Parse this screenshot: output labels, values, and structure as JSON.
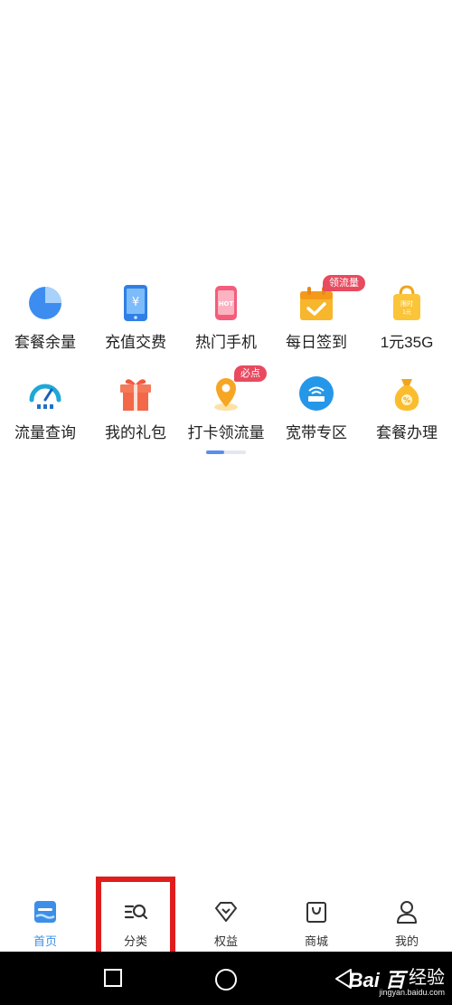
{
  "grid": {
    "row1": [
      {
        "label": "套餐余量",
        "icon": "pie-chart-icon"
      },
      {
        "label": "充值交费",
        "icon": "phone-yen-icon",
        "glyph": "¥"
      },
      {
        "label": "热门手机",
        "icon": "hot-phone-icon",
        "glyph": "HOT"
      },
      {
        "label": "每日签到",
        "icon": "calendar-check-icon",
        "badge": "领流量"
      },
      {
        "label": "1元35G",
        "icon": "shopping-bag-icon",
        "glyph1": "限时",
        "glyph2": "1元"
      }
    ],
    "row2": [
      {
        "label": "流量查询",
        "icon": "speedometer-icon"
      },
      {
        "label": "我的礼包",
        "icon": "gift-box-icon"
      },
      {
        "label": "打卡领流量",
        "icon": "location-pin-icon",
        "badge": "必点"
      },
      {
        "label": "宽带专区",
        "icon": "router-icon"
      },
      {
        "label": "套餐办理",
        "icon": "money-bag-icon",
        "glyph": "%"
      }
    ]
  },
  "pager": {
    "current": 1,
    "total": 2
  },
  "tabs": [
    {
      "label": "首页",
      "icon": "home-icon",
      "active": true
    },
    {
      "label": "分类",
      "icon": "category-search-icon"
    },
    {
      "label": "权益",
      "icon": "diamond-icon"
    },
    {
      "label": "商城",
      "icon": "shopping-bag-icon"
    },
    {
      "label": "我的",
      "icon": "user-icon"
    }
  ],
  "watermark": {
    "logo": "Bai 百",
    "text": "经验",
    "url": "jingyan.baidu.com"
  },
  "colors": {
    "accent": "#3b8fe8",
    "highlight": "#e01d1d",
    "badge": "#e84a5f"
  }
}
